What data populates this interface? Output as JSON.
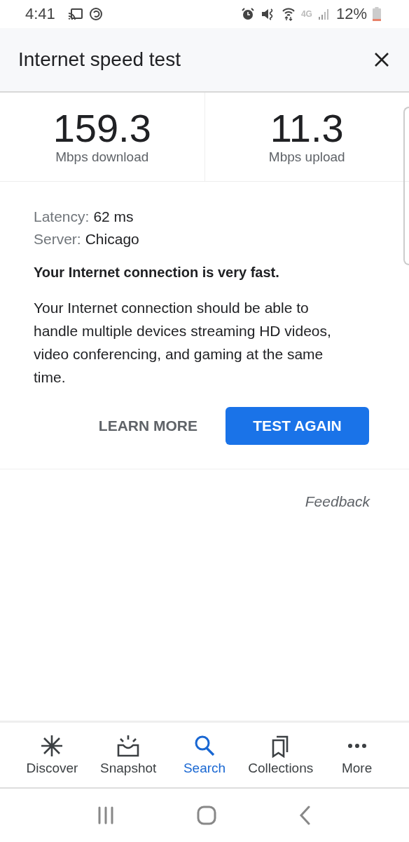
{
  "status_bar": {
    "time": "4:41",
    "network": "4G",
    "battery": "12%"
  },
  "header": {
    "title": "Internet speed test"
  },
  "results": [
    {
      "value": "159.3",
      "label": "Mbps download"
    },
    {
      "value": "11.3",
      "label": "Mbps upload"
    }
  ],
  "details": [
    {
      "label": "Latency:",
      "value": "62 ms"
    },
    {
      "label": "Server:",
      "value": "Chicago"
    }
  ],
  "verdict": "Your Internet connection is very fast.",
  "description": "Your Internet connection should be able to handle multiple devices streaming HD videos, video conferencing, and gaming at the same time.",
  "buttons": [
    {
      "label": "LEARN MORE",
      "kind": "text"
    },
    {
      "label": "TEST AGAIN",
      "kind": "filled"
    }
  ],
  "feedback": "Feedback",
  "bottom_nav": [
    {
      "label": "Discover",
      "selected": false
    },
    {
      "label": "Snapshot",
      "selected": false
    },
    {
      "label": "Search",
      "selected": true
    },
    {
      "label": "Collections",
      "selected": false
    },
    {
      "label": "More",
      "selected": false
    }
  ]
}
